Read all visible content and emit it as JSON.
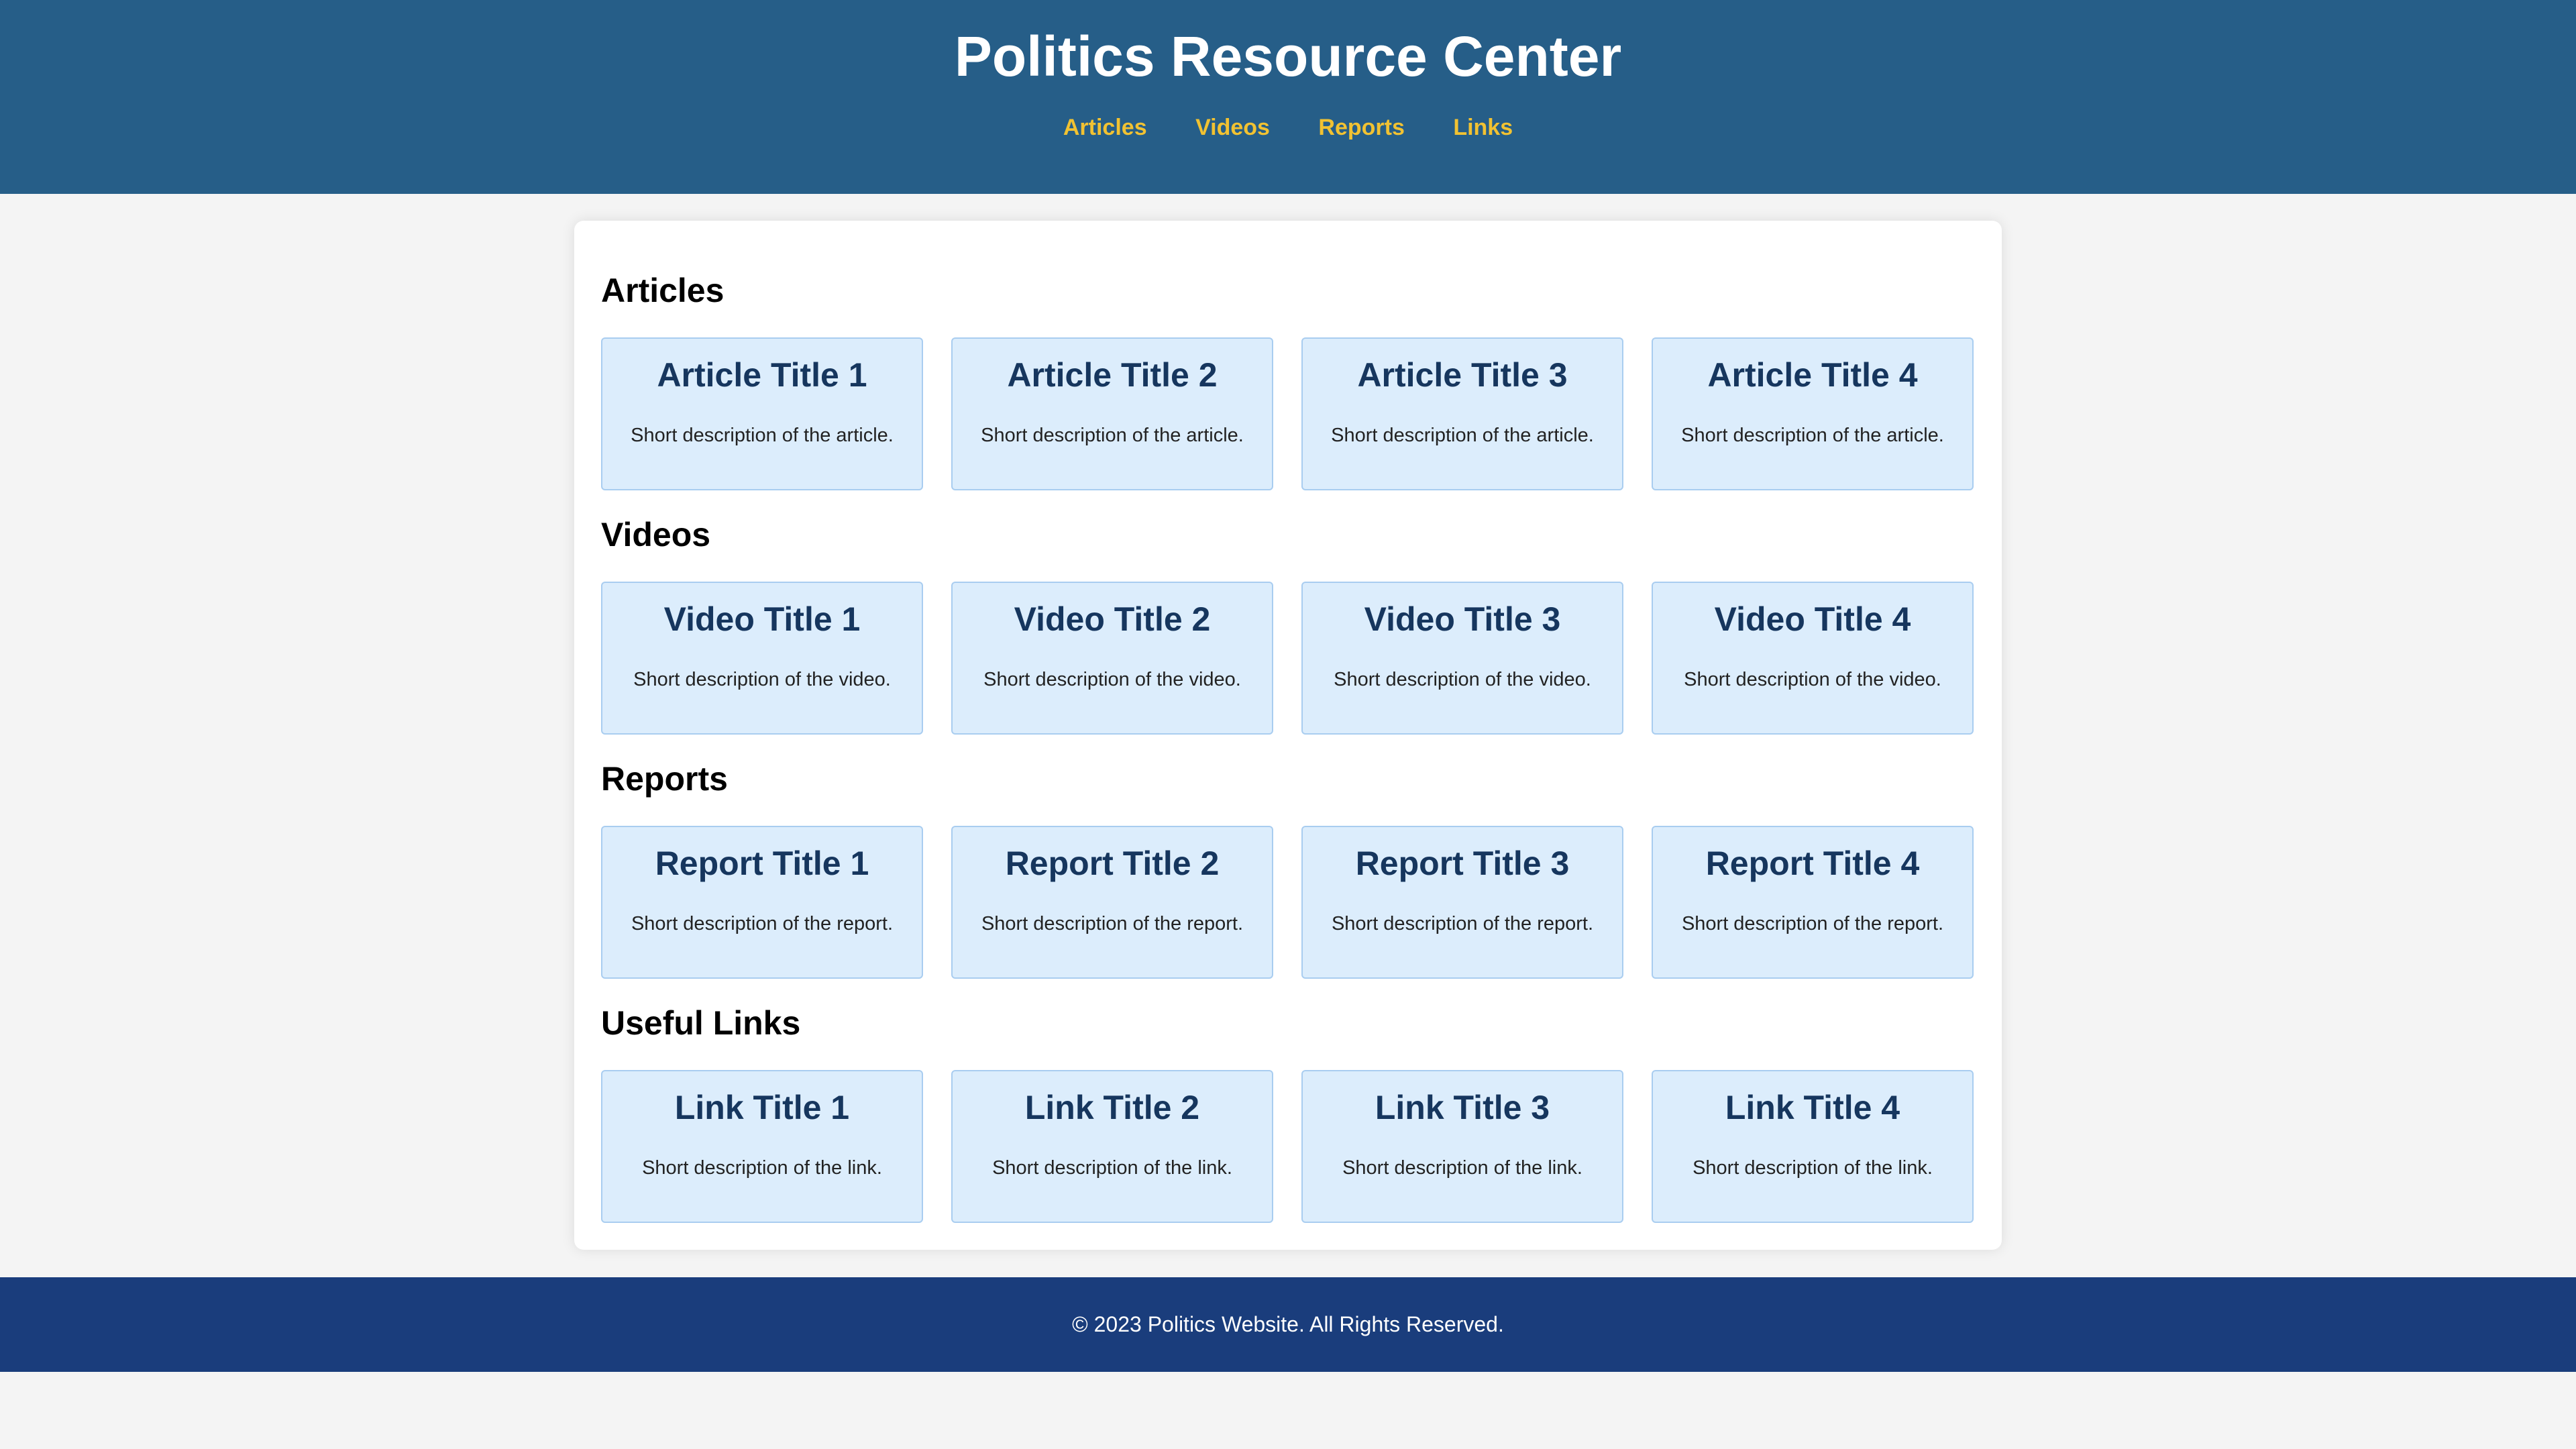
{
  "header": {
    "title": "Politics Resource Center",
    "nav": [
      "Articles",
      "Videos",
      "Reports",
      "Links"
    ]
  },
  "sections": [
    {
      "heading": "Articles",
      "cards": [
        {
          "title": "Article Title 1",
          "description": "Short description of the article."
        },
        {
          "title": "Article Title 2",
          "description": "Short description of the article."
        },
        {
          "title": "Article Title 3",
          "description": "Short description of the article."
        },
        {
          "title": "Article Title 4",
          "description": "Short description of the article."
        }
      ]
    },
    {
      "heading": "Videos",
      "cards": [
        {
          "title": "Video Title 1",
          "description": "Short description of the video."
        },
        {
          "title": "Video Title 2",
          "description": "Short description of the video."
        },
        {
          "title": "Video Title 3",
          "description": "Short description of the video."
        },
        {
          "title": "Video Title 4",
          "description": "Short description of the video."
        }
      ]
    },
    {
      "heading": "Reports",
      "cards": [
        {
          "title": "Report Title 1",
          "description": "Short description of the report."
        },
        {
          "title": "Report Title 2",
          "description": "Short description of the report."
        },
        {
          "title": "Report Title 3",
          "description": "Short description of the report."
        },
        {
          "title": "Report Title 4",
          "description": "Short description of the report."
        }
      ]
    },
    {
      "heading": "Useful Links",
      "cards": [
        {
          "title": "Link Title 1",
          "description": "Short description of the link."
        },
        {
          "title": "Link Title 2",
          "description": "Short description of the link."
        },
        {
          "title": "Link Title 3",
          "description": "Short description of the link."
        },
        {
          "title": "Link Title 4",
          "description": "Short description of the link."
        }
      ]
    }
  ],
  "footer": {
    "text": "© 2023 Politics Website. All Rights Reserved."
  },
  "colors": {
    "header_bg": "#265e88",
    "nav_link": "#f1c232",
    "card_bg": "#dcedfc",
    "card_border": "#a9cdf0",
    "card_title": "#16365e",
    "footer_bg": "#1a3d7c",
    "page_bg": "#f4f4f4"
  }
}
